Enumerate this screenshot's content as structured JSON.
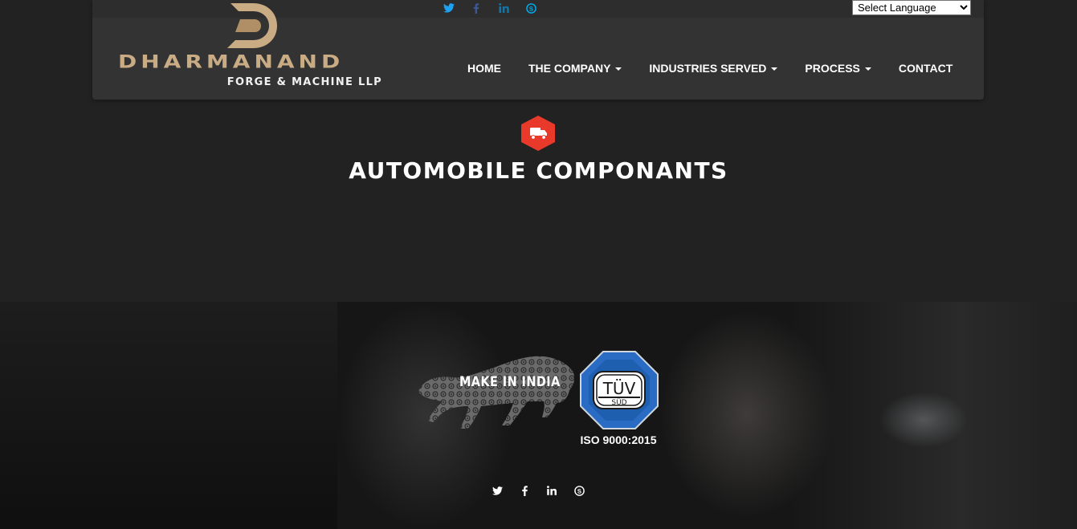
{
  "header": {
    "social": [
      {
        "icon": "twitter-icon",
        "color": "#1da1f2"
      },
      {
        "icon": "facebook-icon",
        "color": "#3b5998"
      },
      {
        "icon": "linkedin-icon",
        "color": "#0e76a8"
      },
      {
        "icon": "skype-icon",
        "color": "#00aff0"
      }
    ],
    "language_select": {
      "selected": "Select Language"
    },
    "logo": {
      "name": "DHARMANAND",
      "subtitle": "FORGE & MACHINE LLP",
      "accent": "#c9ab84"
    },
    "nav": {
      "home": "HOME",
      "company": "THE COMPANY",
      "industries": "INDUSTRIES SERVED",
      "process": "PROCESS",
      "contact": "CONTACT"
    }
  },
  "main": {
    "icon": "truck-icon",
    "icon_color": "#e8392a",
    "title": "AUTOMOBILE COMPONANTS"
  },
  "footer": {
    "make_in_india": "MAKE IN INDIA",
    "tuv": {
      "top": "TÜV",
      "bottom": "SÜD",
      "color": "#1f5fb0"
    },
    "certification": "ISO 9000:2015",
    "social": [
      "twitter-icon",
      "facebook-icon",
      "linkedin-icon",
      "skype-icon"
    ]
  }
}
